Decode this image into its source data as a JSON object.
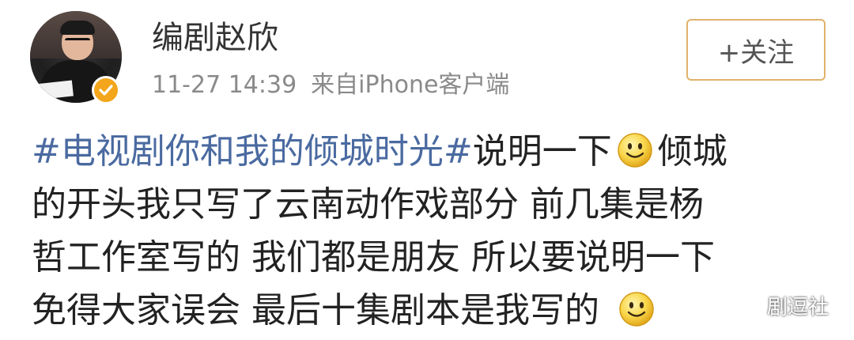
{
  "post": {
    "author": {
      "name": "编剧赵欣",
      "avatar_icon": "user-avatar-photo",
      "verified_icon": "verified-badge-icon",
      "verified_color": "#f3a51b"
    },
    "meta": {
      "time": "11-27 14:39",
      "source": "来自iPhone客户端"
    },
    "follow_button": {
      "label": "+关注",
      "border_color": "#e0b26a"
    },
    "content": {
      "hashtag": "#电视剧你和我的倾城时光#",
      "hashtag_color": "#4a6aa0",
      "line1_text": "说明一下",
      "line1_tail": "倾城",
      "line2": "的开头我只写了云南动作戏部分  前几集是杨",
      "line3": "哲工作室写的  我们都是朋友 所以要说明一下",
      "line4": "免得大家误会  最后十集剧本是我写的",
      "emoji_icon": "smiley-emoji-icon"
    }
  },
  "watermark": {
    "icon": "wechat-icon",
    "text": "剧逗社"
  }
}
